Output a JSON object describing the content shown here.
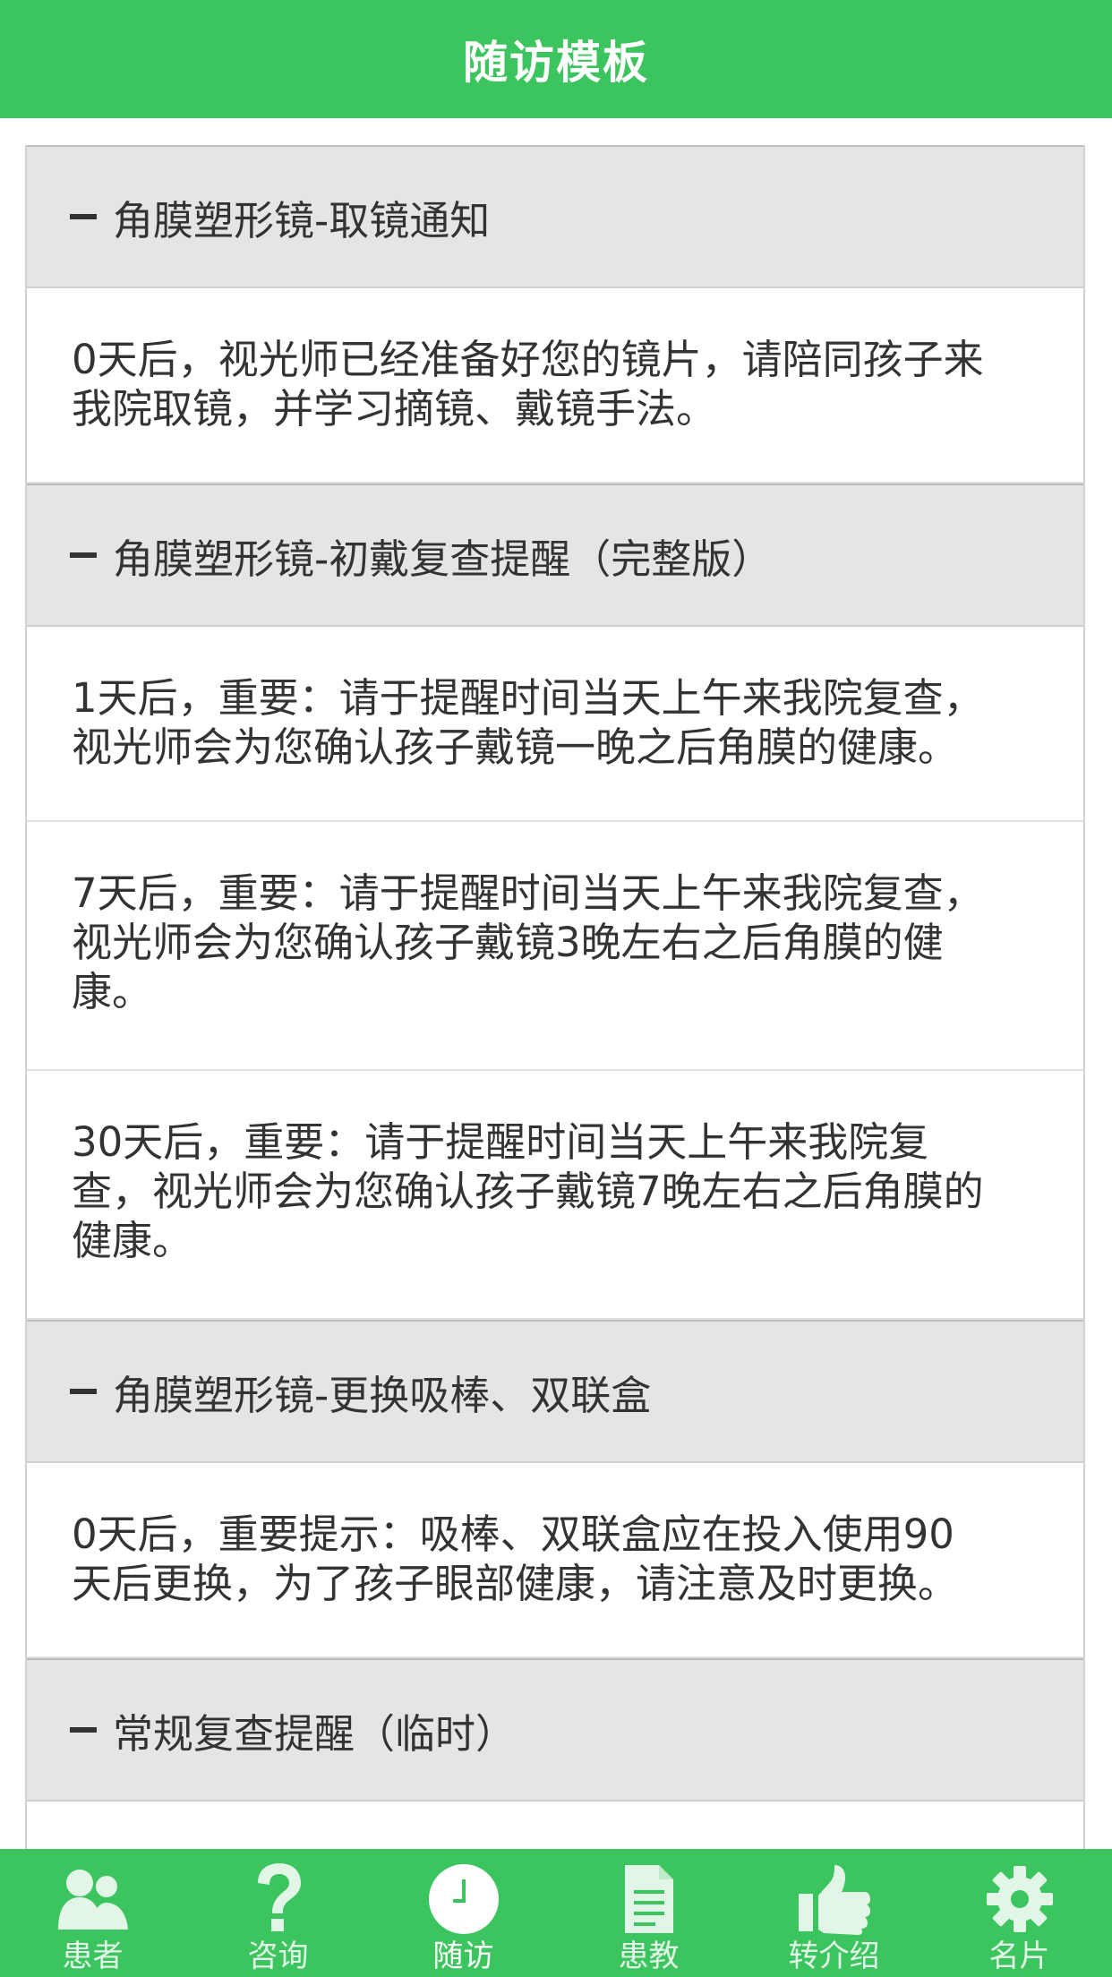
{
  "header": {
    "title": "随访模板"
  },
  "groups": [
    {
      "title": "角膜塑形镜-取镜通知",
      "items": [
        {
          "lines": [
            "0天后，视光师已经准备好您的镜片，请陪同孩子来",
            "我院取镜，并学习摘镜、戴镜手法。"
          ]
        }
      ]
    },
    {
      "title": "角膜塑形镜-初戴复查提醒（完整版）",
      "items": [
        {
          "lines": [
            "1天后，重要：请于提醒时间当天上午来我院复查，",
            "视光师会为您确认孩子戴镜一晚之后角膜的健康。"
          ]
        },
        {
          "lines": [
            "7天后，重要：请于提醒时间当天上午来我院复查，",
            "视光师会为您确认孩子戴镜3晚左右之后角膜的健",
            "康。"
          ]
        },
        {
          "lines": [
            "30天后，重要：请于提醒时间当天上午来我院复",
            "查，视光师会为您确认孩子戴镜7晚左右之后角膜的",
            "健康。"
          ]
        }
      ]
    },
    {
      "title": "角膜塑形镜-更换吸棒、双联盒",
      "items": [
        {
          "lines": [
            "0天后，重要提示：吸棒、双联盒应在投入使用90",
            "天后更换，为了孩子眼部健康，请注意及时更换。"
          ]
        }
      ]
    },
    {
      "title": "常规复查提醒（临时）",
      "items": []
    }
  ],
  "tabs": [
    {
      "label": "患者",
      "icon": "people-icon",
      "active": false
    },
    {
      "label": "咨询",
      "icon": "question-icon",
      "active": false
    },
    {
      "label": "随访",
      "icon": "clock-icon",
      "active": true
    },
    {
      "label": "患教",
      "icon": "document-icon",
      "active": false
    },
    {
      "label": "转介绍",
      "icon": "thumbs-up-icon",
      "active": false
    },
    {
      "label": "名片",
      "icon": "gear-icon",
      "active": false
    }
  ],
  "colors": {
    "brand_green": "#3cc55e",
    "group_header_bg": "#e5e5e5",
    "text": "#333333"
  }
}
